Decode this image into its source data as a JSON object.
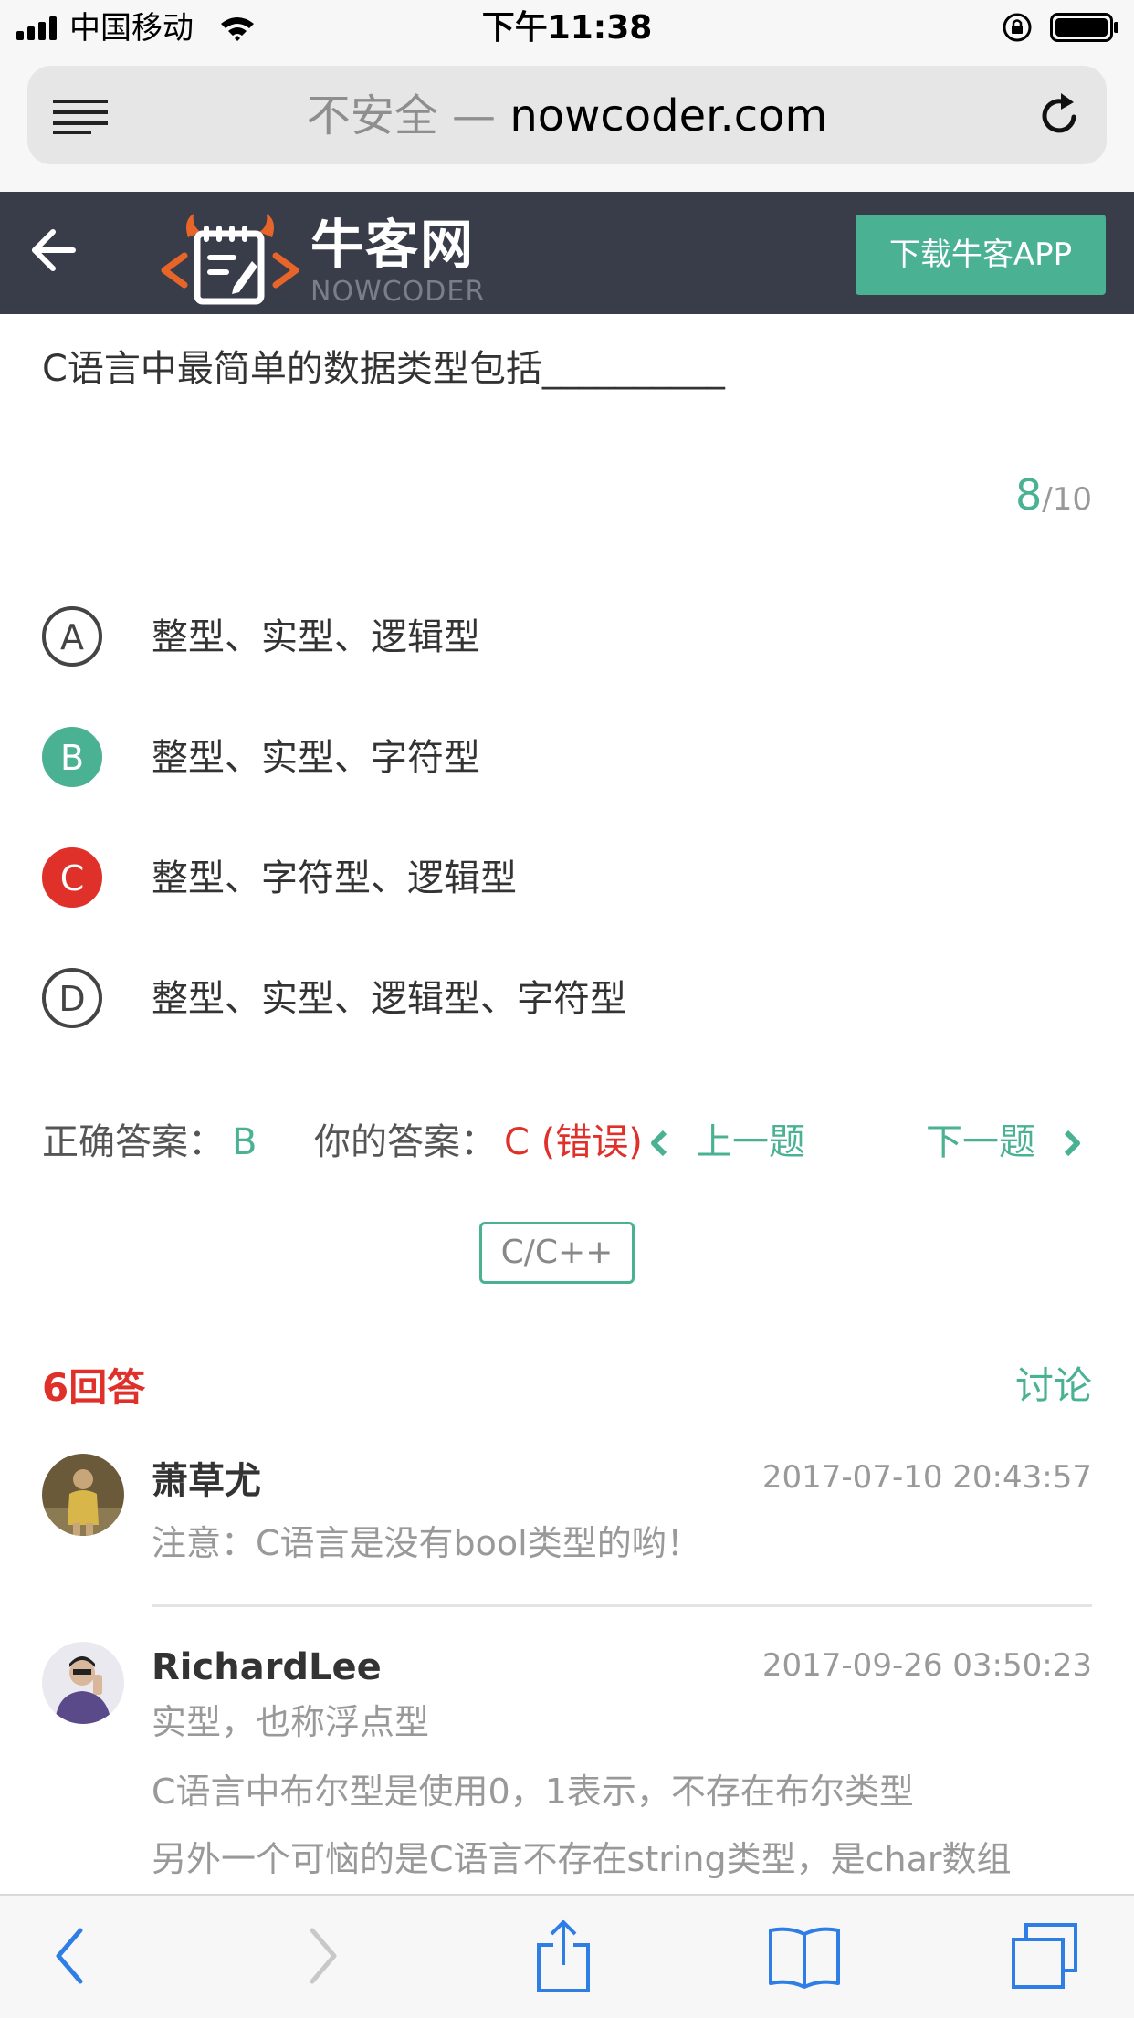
{
  "status_bar": {
    "carrier": "中国移动",
    "time": "下午11:38"
  },
  "browser": {
    "address_insecure": "不安全 —",
    "address_domain": "nowcoder.com"
  },
  "header": {
    "logo_cn": "牛客网",
    "logo_en": "NOWCODER",
    "download_label": "下载牛客APP"
  },
  "question": {
    "text": "C语言中最简单的数据类型包括__________",
    "progress_current": "8",
    "progress_total": "/10",
    "options": [
      {
        "letter": "A",
        "text": "整型、实型、逻辑型",
        "state": "normal"
      },
      {
        "letter": "B",
        "text": "整型、实型、字符型",
        "state": "correct"
      },
      {
        "letter": "C",
        "text": "整型、字符型、逻辑型",
        "state": "wrong"
      },
      {
        "letter": "D",
        "text": "整型、实型、逻辑型、字符型",
        "state": "normal"
      }
    ],
    "correct_label": "正确答案：",
    "correct_value": "B",
    "your_label": "你的答案：",
    "your_value": "C (错误)",
    "prev_label": "上一题",
    "next_label": "下一题",
    "tag": "C/C++"
  },
  "discussion": {
    "count_label": "6回答",
    "discuss_label": "讨论",
    "comments": [
      {
        "name": "萧草尤",
        "time": "2017-07-10 20:43:57",
        "lines": [
          "注意：C语言是没有bool类型的哟！"
        ]
      },
      {
        "name": "RichardLee",
        "time": "2017-09-26 03:50:23",
        "lines": [
          "实型，也称浮点型",
          "C语言中布尔型是使用0，1表示，不存在布尔类型",
          "另外一个可恼的是C语言不存在string类型，是char数组"
        ]
      }
    ]
  },
  "colors": {
    "accent_green": "#4ab293",
    "error_red": "#e0302a",
    "header_bg": "#393d49"
  }
}
